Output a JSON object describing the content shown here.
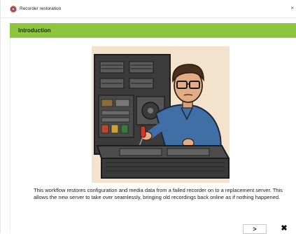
{
  "window": {
    "title": "Recorder restoration",
    "close_glyph": "×"
  },
  "header": {
    "title": "Introduction",
    "background_color": "#8cc63e"
  },
  "main": {
    "illustration_icon": "technician-repairing-server-illustration",
    "description": "This workflow restores configuration and media data from a failed recorder on to a replacement server. This allows the new server to take over seamlessly, bringing old recordings back online as if nothing happened."
  },
  "footer": {
    "next_label": ">",
    "close_label": "✖"
  }
}
